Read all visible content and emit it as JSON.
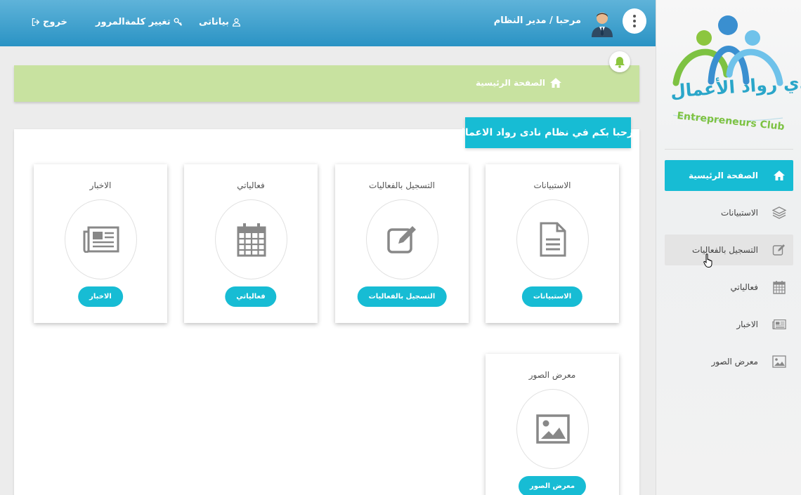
{
  "header": {
    "logout_label": "خروج",
    "change_password_label": "تغيير كلمةالمرور",
    "my_data_label": "بياناتى",
    "greeting": "مرحبا / مدير النظام"
  },
  "breadcrumb": {
    "home_label": "الصفحة الرئيسية"
  },
  "welcome_banner": "مرحبا بكم في نظام نادى رواد الاعمال",
  "logo": {
    "arabic": "نادي رواد الأعمال",
    "english": "Entrepreneurs Club"
  },
  "sidebar": {
    "items": [
      {
        "label": "الصفحة الرئيسية",
        "icon": "home-icon",
        "active": true
      },
      {
        "label": "الاستبيانات",
        "icon": "layers-icon"
      },
      {
        "label": "التسجيل بالفعاليات",
        "icon": "edit-icon",
        "hover": true
      },
      {
        "label": "فعالياتي",
        "icon": "calendar-icon"
      },
      {
        "label": "الاخبار",
        "icon": "newspaper-icon"
      },
      {
        "label": "معرض الصور",
        "icon": "image-icon"
      }
    ]
  },
  "cards": [
    {
      "title": "الاستبيانات",
      "button": "الاستبيانات",
      "icon": "document-icon"
    },
    {
      "title": "التسجيل بالفعاليات",
      "button": "التسجيل بالفعاليات",
      "icon": "edit-icon"
    },
    {
      "title": "فعالياتي",
      "button": "فعالياتي",
      "icon": "calendar-icon"
    },
    {
      "title": "الاخبار",
      "button": "الاخبار",
      "icon": "newspaper-icon"
    },
    {
      "title": "معرض الصور",
      "button": "معرض الصور",
      "icon": "image-icon"
    }
  ],
  "colors": {
    "header": "#2a93c4",
    "accent": "#17bcd4",
    "breadcrumb_bg": "#c8e2a0",
    "logo_green": "#7dc242",
    "logo_blue": "#3a8fd0"
  }
}
